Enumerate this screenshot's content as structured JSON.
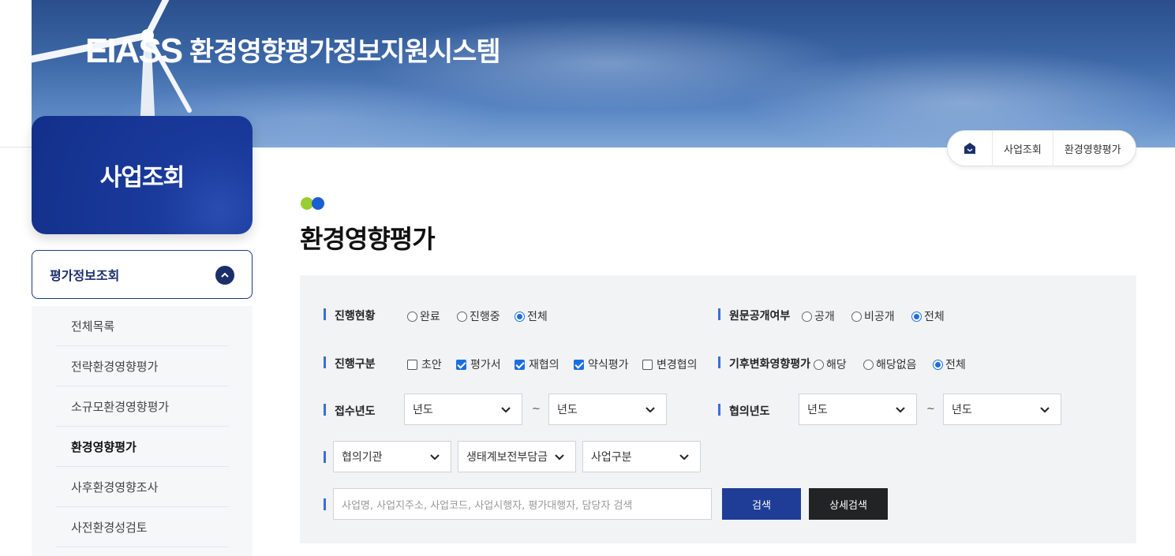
{
  "banner": {
    "brand": "EIASS",
    "title": "환경영향평가정보지원시스템"
  },
  "sidebar": {
    "section_title": "사업조회",
    "group_label": "평가정보조회",
    "items": [
      {
        "label": "전체목록"
      },
      {
        "label": "전략환경영향평가"
      },
      {
        "label": "소규모환경영향평가"
      },
      {
        "label": "환경영향평가"
      },
      {
        "label": "사후환경영향조사"
      },
      {
        "label": "사전환경성검토"
      }
    ],
    "active_index": 3
  },
  "breadcrumb": {
    "items": [
      "사업조회",
      "환경영향평가"
    ]
  },
  "page": {
    "title": "환경영향평가"
  },
  "search": {
    "progress_status": {
      "label": "진행현황",
      "options": [
        "완료",
        "진행중",
        "전체"
      ],
      "selected": "전체"
    },
    "disclosure": {
      "label": "원문공개여부",
      "options": [
        "공개",
        "비공개",
        "전체"
      ],
      "selected": "전체"
    },
    "progress_type": {
      "label": "진행구분",
      "options": [
        {
          "label": "초안",
          "checked": false
        },
        {
          "label": "평가서",
          "checked": true
        },
        {
          "label": "재협의",
          "checked": true
        },
        {
          "label": "약식평가",
          "checked": true
        },
        {
          "label": "변경협의",
          "checked": false
        }
      ]
    },
    "climate": {
      "label": "기후변화영향평가",
      "options": [
        "해당",
        "해당없음",
        "전체"
      ],
      "selected": "전체"
    },
    "receipt_year": {
      "label": "접수년도",
      "from": "년도",
      "to": "년도",
      "separator": "~"
    },
    "consult_year": {
      "label": "협의년도",
      "from": "년도",
      "to": "년도",
      "separator": "~"
    },
    "agency_select": "협의기관",
    "ecosystem_select": "생태계보전부담금",
    "project_type_select": "사업구분",
    "keyword_placeholder": "사업명, 사업지주소, 사업코드, 사업시행자, 평가대행자, 담당자 검색",
    "search_button": "검색",
    "detail_button": "상세검색"
  },
  "colors": {
    "primary": "#1f3d96",
    "accent": "#1a6fe0",
    "dark_button": "#222325"
  }
}
